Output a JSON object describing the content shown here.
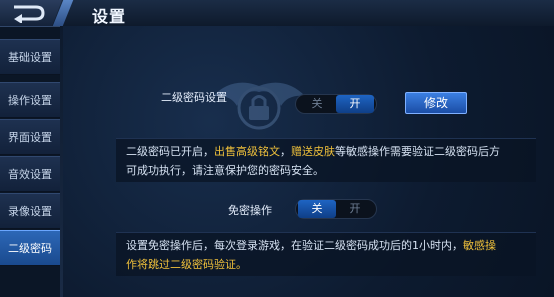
{
  "header": {
    "title": "设置"
  },
  "sidebar": {
    "items": [
      {
        "label": "基础设置"
      },
      {
        "label": "操作设置"
      },
      {
        "label": "界面设置"
      },
      {
        "label": "音效设置"
      },
      {
        "label": "录像设置"
      },
      {
        "label": "二级密码",
        "active": true
      }
    ]
  },
  "password": {
    "label": "二级密码设置",
    "toggle_off": "关",
    "toggle_on": "开",
    "selected": "开",
    "edit_button": "修改",
    "desc_part1": "二级密码已开启，",
    "desc_hl1": "出售高级铭文",
    "desc_part2": "，",
    "desc_hl2": "赠送皮肤",
    "desc_part3": "等敏感操作需要验证二级密码后方",
    "desc_line2": "可成功执行，请注意保护您的密码安全。"
  },
  "nopass": {
    "label": "免密操作",
    "toggle_on": "关",
    "toggle_off": "开",
    "selected": "关",
    "desc_part1": "设置免密操作后，每次登录游戏，在验证二级密码成功后的1小时内，",
    "desc_hl1": "敏感操",
    "desc_hl2": "作将跳过二级密码验证。"
  },
  "colors": {
    "accent": "#1e64c3",
    "highlight": "#f0c13b",
    "background": "#0b1626"
  }
}
